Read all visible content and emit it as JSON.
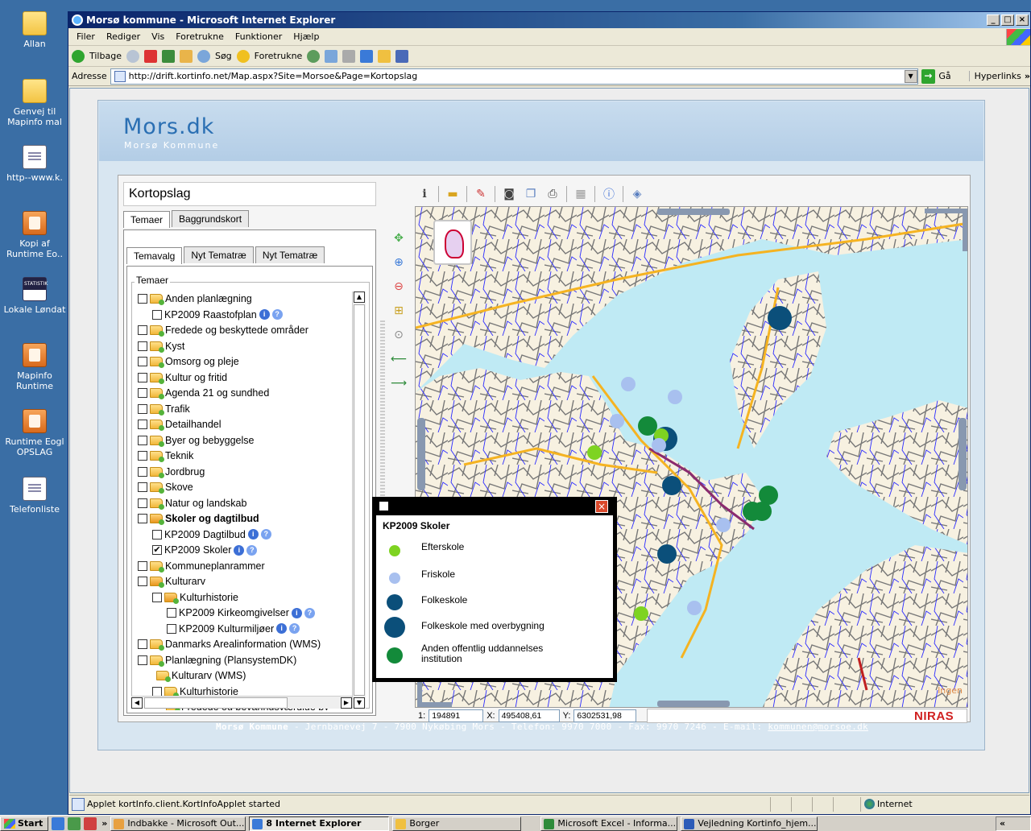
{
  "desktop": {
    "icons": [
      {
        "label": "Allan",
        "kind": "folder"
      },
      {
        "label": "Genvej til Mapinfo mal",
        "kind": "folder"
      },
      {
        "label": "http--www.k.",
        "kind": "doc"
      },
      {
        "label": "Kopi af Runtime Eo..",
        "kind": "orange"
      },
      {
        "label": "Lokale Løndat",
        "kind": "stat"
      },
      {
        "label": "Mapinfo Runtime",
        "kind": "orange"
      },
      {
        "label": "Runtime Eogl OPSLAG",
        "kind": "orange"
      },
      {
        "label": "Telefonliste",
        "kind": "doc"
      }
    ]
  },
  "window": {
    "title": "Morsø kommune - Microsoft Internet Explorer",
    "controls": {
      "minimize": "_",
      "maximize": "□",
      "close": "×"
    }
  },
  "menu": [
    "Filer",
    "Rediger",
    "Vis",
    "Foretrukne",
    "Funktioner",
    "Hjælp"
  ],
  "toolbar": {
    "back": "Tilbage",
    "search": "Søg",
    "favorites": "Foretrukne"
  },
  "address": {
    "label": "Adresse",
    "url": "http://drift.kortinfo.net/Map.aspx?Site=Morsoe&Page=Kortopslag",
    "go": "Gå",
    "links": "Hyperlinks"
  },
  "portal": {
    "logo": "Mors.dk",
    "logo_sub": "Morsø Kommune",
    "footer": {
      "org": "Morsø Kommune",
      "details": " - Jernbanevej 7 - 7900 Nykøbing Mors - Telefon: 9970 7000 - Fax: 9970 7246 - E-mail: ",
      "email": "kommunen@morsoe.dk"
    }
  },
  "panel": {
    "title": "Kortopslag",
    "tabs": [
      "Temaer",
      "Baggrundskort"
    ],
    "subtabs": [
      "Temavalg",
      "Nyt Tematræ",
      "Nyt Tematræ"
    ],
    "group_label": "Temaer"
  },
  "tree": [
    {
      "label": "Anden planlægning",
      "indent": 0,
      "checkbox": true,
      "folder": true
    },
    {
      "label": "KP2009 Raastofplan",
      "indent": 1,
      "checkbox": true,
      "folder": false,
      "info": true
    },
    {
      "label": "Fredede og beskyttede områder",
      "indent": 0,
      "checkbox": true,
      "folder": true
    },
    {
      "label": "Kyst",
      "indent": 0,
      "checkbox": true,
      "folder": true
    },
    {
      "label": "Omsorg og pleje",
      "indent": 0,
      "checkbox": true,
      "folder": true
    },
    {
      "label": "Kultur og fritid",
      "indent": 0,
      "checkbox": true,
      "folder": true
    },
    {
      "label": "Agenda 21 og sundhed",
      "indent": 0,
      "checkbox": true,
      "folder": true
    },
    {
      "label": "Trafik",
      "indent": 0,
      "checkbox": true,
      "folder": true
    },
    {
      "label": "Detailhandel",
      "indent": 0,
      "checkbox": true,
      "folder": true
    },
    {
      "label": "Byer og bebyggelse",
      "indent": 0,
      "checkbox": true,
      "folder": true
    },
    {
      "label": "Teknik",
      "indent": 0,
      "checkbox": true,
      "folder": true
    },
    {
      "label": "Jordbrug",
      "indent": 0,
      "checkbox": true,
      "folder": true
    },
    {
      "label": "Skove",
      "indent": 0,
      "checkbox": true,
      "folder": true
    },
    {
      "label": "Natur og landskab",
      "indent": 0,
      "checkbox": true,
      "folder": true
    },
    {
      "label": "Skoler og dagtilbud",
      "indent": 0,
      "checkbox": true,
      "folder": true,
      "bold": true,
      "open": true
    },
    {
      "label": "KP2009 Dagtilbud",
      "indent": 1,
      "checkbox": true,
      "folder": false,
      "info": true
    },
    {
      "label": "KP2009 Skoler",
      "indent": 1,
      "checkbox": true,
      "checked": true,
      "folder": false,
      "info": true
    },
    {
      "label": "Kommuneplanrammer",
      "indent": 0,
      "checkbox": true,
      "folder": true
    },
    {
      "label": "Kulturarv",
      "indent": 0,
      "checkbox": true,
      "folder": true,
      "open": true
    },
    {
      "label": "Kulturhistorie",
      "indent": 1,
      "checkbox": true,
      "folder": true,
      "open": true
    },
    {
      "label": "KP2009 Kirkeomgivelser",
      "indent": 2,
      "checkbox": true,
      "folder": false,
      "info": true
    },
    {
      "label": "KP2009 Kulturmiljøer",
      "indent": 2,
      "checkbox": true,
      "folder": false,
      "info": true
    },
    {
      "label": "Danmarks Arealinformation (WMS)",
      "indent": 0,
      "checkbox": true,
      "folder": true
    },
    {
      "label": "Planlægning (PlansystemDK)",
      "indent": 0,
      "checkbox": true,
      "folder": true
    },
    {
      "label": "Kulturarv (WMS)",
      "indent": 1,
      "checkbox": false,
      "folder": true
    },
    {
      "label": "Kulturhistorie",
      "indent": 1,
      "checkbox": true,
      "folder": true
    },
    {
      "label": "Fredede og bevaringsværdige by",
      "indent": 1,
      "checkbox": false,
      "folder": true,
      "shift": true
    }
  ],
  "coords": {
    "scale_prefix": "1:",
    "scale": "194891",
    "x_label": "X:",
    "x": "495408,61",
    "y_label": "Y:",
    "y": "6302531,98"
  },
  "brand": "NIRAS",
  "map_label": "Ingen",
  "legend": {
    "title": "KP2009 Skoler",
    "close": "×",
    "items": [
      {
        "label": "Efterskole",
        "color": "#7ed321",
        "size": 14
      },
      {
        "label": "Friskole",
        "color": "#a8c0ef",
        "size": 14
      },
      {
        "label": "Folkeskole",
        "color": "#0b4f7a",
        "size": 20
      },
      {
        "label": "Folkeskole med overbygning",
        "color": "#0b4f7a",
        "size": 26
      },
      {
        "label": "Anden offentlig uddannelses institution",
        "color": "#138a3a",
        "size": 20
      }
    ]
  },
  "status": {
    "message": "Applet kortInfo.client.KortInfoApplet started",
    "zone": "Internet"
  },
  "taskbar": {
    "start": "Start",
    "tasks": [
      {
        "label": "Indbakke - Microsoft Out...",
        "color": "#e8a040"
      },
      {
        "label": "8 Internet Explorer",
        "color": "#3a7ad8",
        "pressed": true
      },
      {
        "label": "Borger",
        "color": "#f0c040"
      },
      {
        "label": "Microsoft Excel - Informa...",
        "color": "#2e8b3a"
      },
      {
        "label": "Vejledning Kortinfo_hjem...",
        "color": "#2c5bb8"
      }
    ],
    "tray": "«"
  }
}
